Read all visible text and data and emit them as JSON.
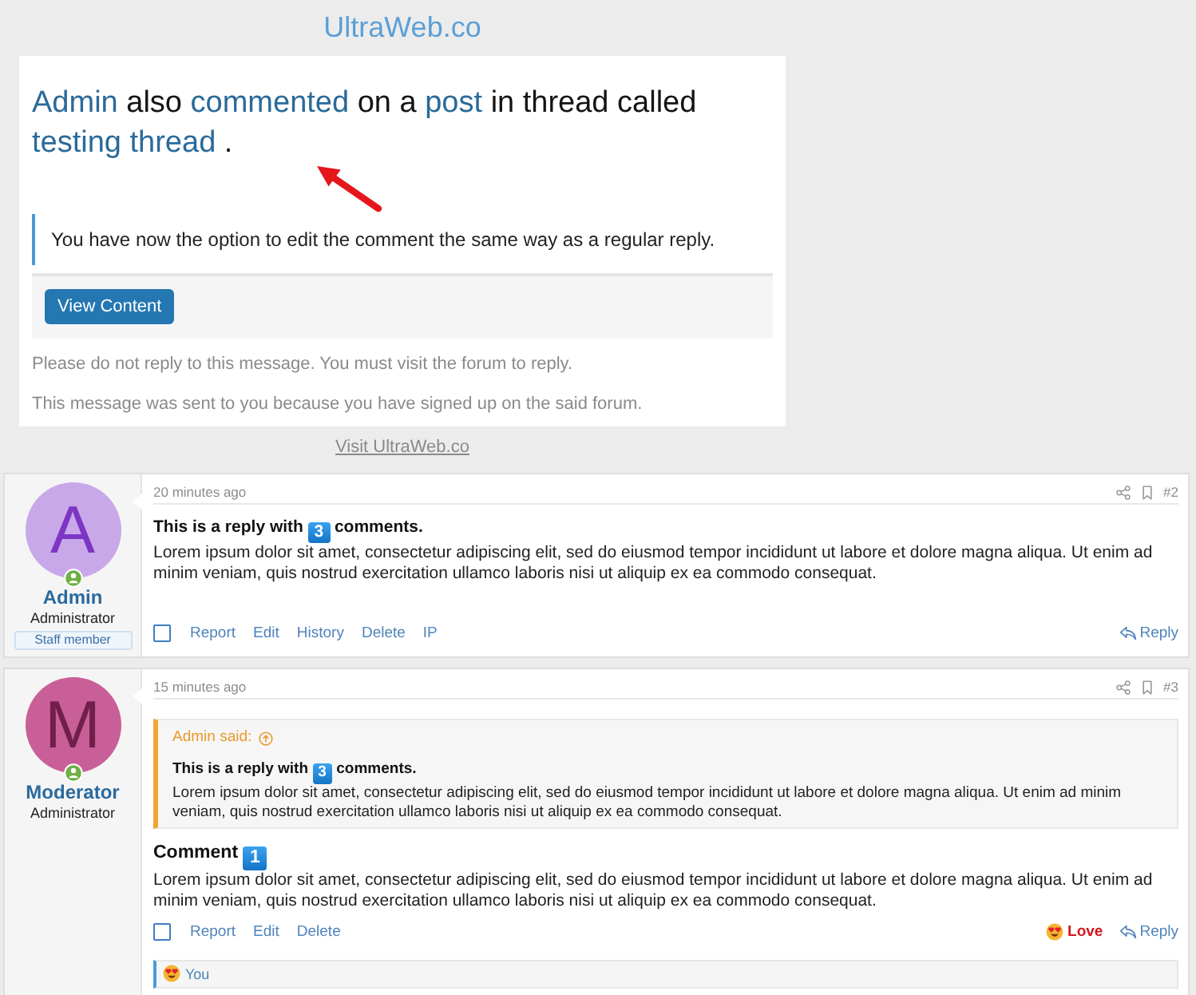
{
  "site_title": "UltraWeb.co",
  "email": {
    "headline": [
      {
        "text": "Admin",
        "kind": "link"
      },
      {
        "text": "also",
        "kind": "text"
      },
      {
        "text": "commented",
        "kind": "link"
      },
      {
        "text": "on a",
        "kind": "text"
      },
      {
        "text": "post",
        "kind": "link"
      },
      {
        "text": "in thread called",
        "kind": "text"
      },
      {
        "text": "testing thread",
        "kind": "link"
      },
      {
        "text": ".",
        "kind": "text"
      }
    ],
    "note": "You have now the option to edit the comment the same way as a regular reply.",
    "button": "View Content",
    "footer": [
      "Please do not reply to this message. You must visit the forum to reply.",
      "This message was sent to you because you have signed up on the said forum."
    ],
    "visit_link": "Visit UltraWeb.co"
  },
  "posts": [
    {
      "user": {
        "initial": "A",
        "color": "#c8a8e9",
        "name": "Admin",
        "role": "Administrator",
        "badge": "Staff member"
      },
      "time": "20 minutes ago",
      "number": "#2",
      "title": [
        {
          "text": "This is a reply with",
          "kind": "text"
        },
        {
          "text": "3",
          "kind": "keycap"
        },
        {
          "text": "comments.",
          "kind": "text"
        }
      ],
      "body": "Lorem ipsum dolor sit amet, consectetur adipiscing elit, sed do eiusmod tempor incididunt ut labore et dolore magna aliqua. Ut enim ad minim veniam, quis nostrud exercitation ullamco laboris nisi ut aliquip ex ea commodo consequat.",
      "checked": false,
      "actions": [
        "Report",
        "Edit",
        "History",
        "Delete",
        "IP"
      ],
      "reply": "Reply"
    },
    {
      "user": {
        "initial": "M",
        "color": "#c95f98",
        "name": "Moderator",
        "role": "Administrator"
      },
      "time": "15 minutes ago",
      "number": "#3",
      "quote": {
        "author": "Admin said:",
        "title": [
          {
            "text": "This is a reply with",
            "kind": "text"
          },
          {
            "text": "3",
            "kind": "keycap"
          },
          {
            "text": "comments.",
            "kind": "text"
          }
        ],
        "body": "Lorem ipsum dolor sit amet, consectetur adipiscing elit, sed do eiusmod tempor incididunt ut labore et dolore magna aliqua. Ut enim ad minim veniam, quis nostrud exercitation ullamco laboris nisi ut aliquip ex ea commodo consequat."
      },
      "title": [
        {
          "text": "Comment",
          "kind": "text"
        },
        {
          "text": "1",
          "kind": "keycap"
        }
      ],
      "body": "Lorem ipsum dolor sit amet, consectetur adipiscing elit, sed do eiusmod tempor incididunt ut labore et dolore magna aliqua. Ut enim ad minim veniam, quis nostrud exercitation ullamco laboris nisi ut aliquip ex ea commodo consequat.",
      "checked": false,
      "actions": [
        "Report",
        "Edit",
        "Delete"
      ],
      "reaction": "Love",
      "reply": "Reply",
      "reactions_bar": "You"
    }
  ]
}
